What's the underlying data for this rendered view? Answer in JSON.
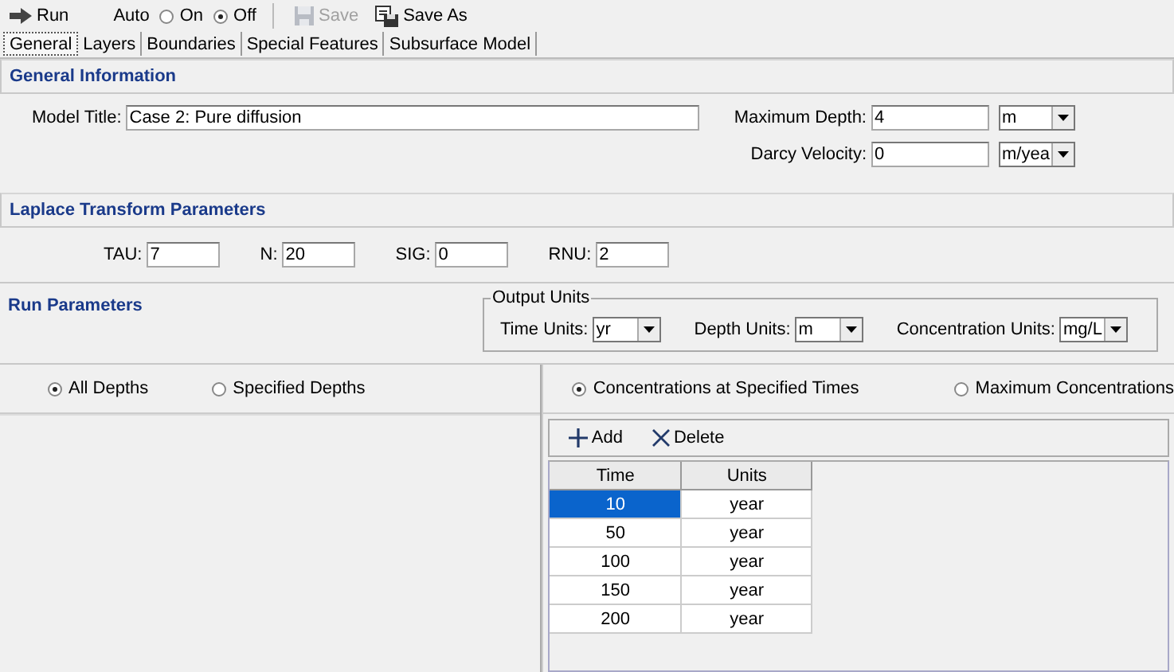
{
  "toolbar": {
    "run": "Run",
    "auto_label": "Auto",
    "auto_options": [
      {
        "label": "On",
        "selected": false
      },
      {
        "label": "Off",
        "selected": true
      }
    ],
    "save": {
      "label": "Save",
      "disabled": true
    },
    "save_as": {
      "label": "Save As",
      "disabled": false
    }
  },
  "tabs": [
    {
      "label": "General",
      "selected": true
    },
    {
      "label": "Layers",
      "selected": false
    },
    {
      "label": "Boundaries",
      "selected": false
    },
    {
      "label": "Special Features",
      "selected": false
    },
    {
      "label": "Subsurface Model",
      "selected": false
    }
  ],
  "general_information": {
    "title": "General Information",
    "model_title": {
      "label": "Model Title:",
      "value": "Case 2: Pure diffusion"
    },
    "maximum_depth": {
      "label": "Maximum Depth:",
      "value": "4",
      "unit": "m"
    },
    "darcy_velocity": {
      "label": "Darcy Velocity:",
      "value": "0",
      "unit": "m/yea"
    }
  },
  "laplace": {
    "title": "Laplace Transform Parameters",
    "fields": [
      {
        "label": "TAU:",
        "value": "7"
      },
      {
        "label": "N:",
        "value": "20"
      },
      {
        "label": "SIG:",
        "value": "0"
      },
      {
        "label": "RNU:",
        "value": "2"
      }
    ]
  },
  "run_parameters": {
    "title": "Run Parameters",
    "output_units": {
      "title": "Output Units",
      "fields": [
        {
          "label": "Time Units:",
          "value": "yr"
        },
        {
          "label": "Depth Units:",
          "value": "m"
        },
        {
          "label": "Concentration Units:",
          "value": "mg/L"
        }
      ]
    }
  },
  "depth_options": [
    {
      "label": "All Depths",
      "selected": true
    },
    {
      "label": "Specified Depths",
      "selected": false
    }
  ],
  "time_options": [
    {
      "label": "Concentrations at Specified Times",
      "selected": true
    },
    {
      "label": "Maximum Concentrations",
      "selected": false
    }
  ],
  "table_toolbar": {
    "add": "Add",
    "delete": "Delete"
  },
  "table": {
    "columns": [
      "Time",
      "Units"
    ],
    "rows": [
      {
        "time": "10",
        "units": "year",
        "selected": true
      },
      {
        "time": "50",
        "units": "year",
        "selected": false
      },
      {
        "time": "100",
        "units": "year",
        "selected": false
      },
      {
        "time": "150",
        "units": "year",
        "selected": false
      },
      {
        "time": "200",
        "units": "year",
        "selected": false
      }
    ]
  }
}
